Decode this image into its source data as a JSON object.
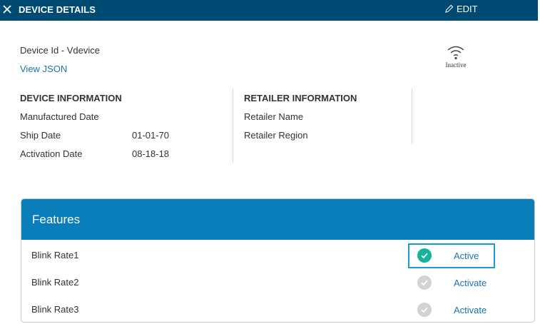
{
  "header": {
    "title": "DEVICE DETAILS",
    "edit_label": "EDIT"
  },
  "device": {
    "id_label": "Device Id - Vdevice",
    "view_json": "View JSON",
    "status": "Inactive"
  },
  "device_info": {
    "heading": "DEVICE INFORMATION",
    "rows": [
      {
        "label": "Manufactured Date",
        "value": ""
      },
      {
        "label": "Ship Date",
        "value": "01-01-70"
      },
      {
        "label": "Activation Date",
        "value": "08-18-18"
      }
    ]
  },
  "retailer_info": {
    "heading": "RETAILER INFORMATION",
    "rows": [
      {
        "label": "Retailer Name"
      },
      {
        "label": "Retailer Region"
      }
    ]
  },
  "features": {
    "title": "Features",
    "items": [
      {
        "name": "Blink Rate1",
        "action": "Active",
        "enabled": true
      },
      {
        "name": "Blink Rate2",
        "action": "Activate",
        "enabled": false
      },
      {
        "name": "Blink Rate3",
        "action": "Activate",
        "enabled": false
      }
    ]
  },
  "colors": {
    "header_bg": "#004b73",
    "features_header_bg": "#0a7dbb",
    "link": "#1a73a8",
    "check_active": "#19b39b",
    "check_inactive": "#d3d3d3",
    "highlight_border": "#1a9ad6"
  },
  "icons": {
    "close": "close-icon",
    "edit": "pencil-icon",
    "status": "wifi-icon",
    "check": "check-circle-icon"
  }
}
